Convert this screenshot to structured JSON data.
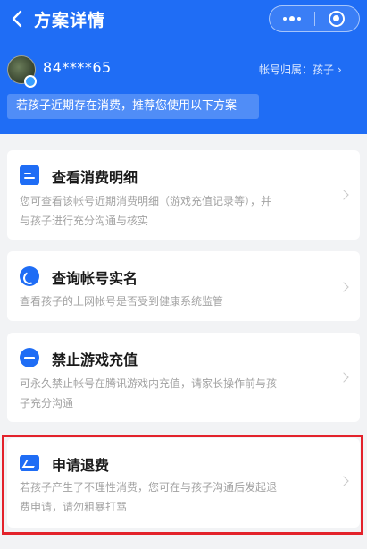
{
  "nav": {
    "title": "方案详情"
  },
  "account": {
    "masked_id": "84****65",
    "owner_label": "帐号归属：孩子"
  },
  "tip": "若孩子近期存在消费，推荐您使用以下方案",
  "cards": [
    {
      "title": "查看消费明细",
      "desc_line1": "您可查看该帐号近期消费明细（游戏充值记录等），并",
      "desc_line2": "与孩子进行充分沟通与核实",
      "icon": "document-icon"
    },
    {
      "title": "查询帐号实名",
      "desc_line1": "查看孩子的上网帐号是否受到健康系统监管",
      "icon": "search-icon"
    },
    {
      "title": "禁止游戏充值",
      "desc_line1": "可永久禁止帐号在腾讯游戏内充值，请家长操作前与孩",
      "desc_line2": "子充分沟通",
      "icon": "ban-icon"
    },
    {
      "title": "申请退费",
      "desc_line1": "若孩子产生了不理性消费，您可在与孩子沟通后发起退",
      "desc_line2": "费申请，请勿粗暴打骂",
      "icon": "refund-icon"
    }
  ],
  "colors": {
    "brand": "#1f6df5",
    "highlight": "#e3222b"
  }
}
